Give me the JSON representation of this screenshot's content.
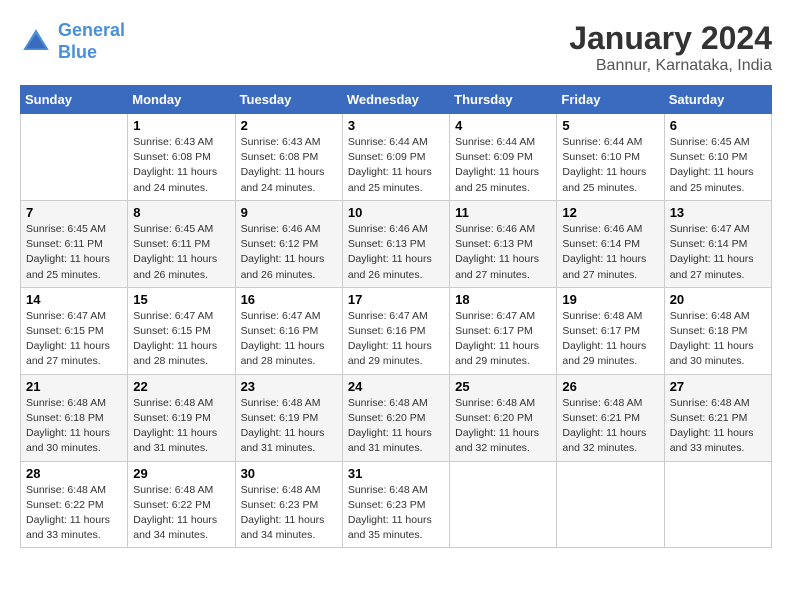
{
  "header": {
    "logo_line1": "General",
    "logo_line2": "Blue",
    "month": "January 2024",
    "location": "Bannur, Karnataka, India"
  },
  "weekdays": [
    "Sunday",
    "Monday",
    "Tuesday",
    "Wednesday",
    "Thursday",
    "Friday",
    "Saturday"
  ],
  "weeks": [
    [
      {
        "day": "",
        "info": ""
      },
      {
        "day": "1",
        "info": "Sunrise: 6:43 AM\nSunset: 6:08 PM\nDaylight: 11 hours\nand 24 minutes."
      },
      {
        "day": "2",
        "info": "Sunrise: 6:43 AM\nSunset: 6:08 PM\nDaylight: 11 hours\nand 24 minutes."
      },
      {
        "day": "3",
        "info": "Sunrise: 6:44 AM\nSunset: 6:09 PM\nDaylight: 11 hours\nand 25 minutes."
      },
      {
        "day": "4",
        "info": "Sunrise: 6:44 AM\nSunset: 6:09 PM\nDaylight: 11 hours\nand 25 minutes."
      },
      {
        "day": "5",
        "info": "Sunrise: 6:44 AM\nSunset: 6:10 PM\nDaylight: 11 hours\nand 25 minutes."
      },
      {
        "day": "6",
        "info": "Sunrise: 6:45 AM\nSunset: 6:10 PM\nDaylight: 11 hours\nand 25 minutes."
      }
    ],
    [
      {
        "day": "7",
        "info": "Sunrise: 6:45 AM\nSunset: 6:11 PM\nDaylight: 11 hours\nand 25 minutes."
      },
      {
        "day": "8",
        "info": "Sunrise: 6:45 AM\nSunset: 6:11 PM\nDaylight: 11 hours\nand 26 minutes."
      },
      {
        "day": "9",
        "info": "Sunrise: 6:46 AM\nSunset: 6:12 PM\nDaylight: 11 hours\nand 26 minutes."
      },
      {
        "day": "10",
        "info": "Sunrise: 6:46 AM\nSunset: 6:13 PM\nDaylight: 11 hours\nand 26 minutes."
      },
      {
        "day": "11",
        "info": "Sunrise: 6:46 AM\nSunset: 6:13 PM\nDaylight: 11 hours\nand 27 minutes."
      },
      {
        "day": "12",
        "info": "Sunrise: 6:46 AM\nSunset: 6:14 PM\nDaylight: 11 hours\nand 27 minutes."
      },
      {
        "day": "13",
        "info": "Sunrise: 6:47 AM\nSunset: 6:14 PM\nDaylight: 11 hours\nand 27 minutes."
      }
    ],
    [
      {
        "day": "14",
        "info": "Sunrise: 6:47 AM\nSunset: 6:15 PM\nDaylight: 11 hours\nand 27 minutes."
      },
      {
        "day": "15",
        "info": "Sunrise: 6:47 AM\nSunset: 6:15 PM\nDaylight: 11 hours\nand 28 minutes."
      },
      {
        "day": "16",
        "info": "Sunrise: 6:47 AM\nSunset: 6:16 PM\nDaylight: 11 hours\nand 28 minutes."
      },
      {
        "day": "17",
        "info": "Sunrise: 6:47 AM\nSunset: 6:16 PM\nDaylight: 11 hours\nand 29 minutes."
      },
      {
        "day": "18",
        "info": "Sunrise: 6:47 AM\nSunset: 6:17 PM\nDaylight: 11 hours\nand 29 minutes."
      },
      {
        "day": "19",
        "info": "Sunrise: 6:48 AM\nSunset: 6:17 PM\nDaylight: 11 hours\nand 29 minutes."
      },
      {
        "day": "20",
        "info": "Sunrise: 6:48 AM\nSunset: 6:18 PM\nDaylight: 11 hours\nand 30 minutes."
      }
    ],
    [
      {
        "day": "21",
        "info": "Sunrise: 6:48 AM\nSunset: 6:18 PM\nDaylight: 11 hours\nand 30 minutes."
      },
      {
        "day": "22",
        "info": "Sunrise: 6:48 AM\nSunset: 6:19 PM\nDaylight: 11 hours\nand 31 minutes."
      },
      {
        "day": "23",
        "info": "Sunrise: 6:48 AM\nSunset: 6:19 PM\nDaylight: 11 hours\nand 31 minutes."
      },
      {
        "day": "24",
        "info": "Sunrise: 6:48 AM\nSunset: 6:20 PM\nDaylight: 11 hours\nand 31 minutes."
      },
      {
        "day": "25",
        "info": "Sunrise: 6:48 AM\nSunset: 6:20 PM\nDaylight: 11 hours\nand 32 minutes."
      },
      {
        "day": "26",
        "info": "Sunrise: 6:48 AM\nSunset: 6:21 PM\nDaylight: 11 hours\nand 32 minutes."
      },
      {
        "day": "27",
        "info": "Sunrise: 6:48 AM\nSunset: 6:21 PM\nDaylight: 11 hours\nand 33 minutes."
      }
    ],
    [
      {
        "day": "28",
        "info": "Sunrise: 6:48 AM\nSunset: 6:22 PM\nDaylight: 11 hours\nand 33 minutes."
      },
      {
        "day": "29",
        "info": "Sunrise: 6:48 AM\nSunset: 6:22 PM\nDaylight: 11 hours\nand 34 minutes."
      },
      {
        "day": "30",
        "info": "Sunrise: 6:48 AM\nSunset: 6:23 PM\nDaylight: 11 hours\nand 34 minutes."
      },
      {
        "day": "31",
        "info": "Sunrise: 6:48 AM\nSunset: 6:23 PM\nDaylight: 11 hours\nand 35 minutes."
      },
      {
        "day": "",
        "info": ""
      },
      {
        "day": "",
        "info": ""
      },
      {
        "day": "",
        "info": ""
      }
    ]
  ]
}
